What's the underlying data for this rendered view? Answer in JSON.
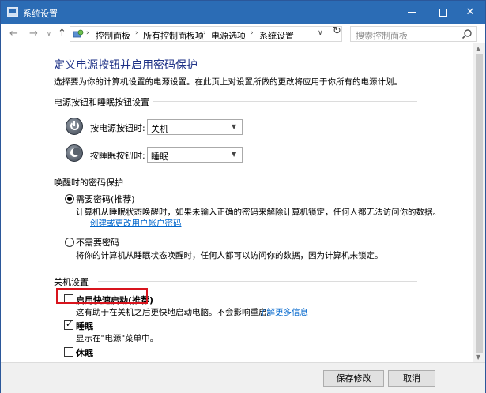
{
  "window": {
    "title": "系统设置",
    "minimize_icon": "minimize-icon",
    "maximize_icon": "maximize-icon",
    "close_icon": "close-icon",
    "close_glyph": "✕"
  },
  "navbar": {
    "back_glyph": "←",
    "forward_glyph": "→",
    "history_glyph": "∨",
    "up_glyph": "↑",
    "breadcrumb": [
      "控制面板",
      "所有控制面板项",
      "电源选项",
      "系统设置"
    ],
    "separator": "›",
    "dropdown_glyph": "∨",
    "refresh_glyph": "↻",
    "search_placeholder": "搜索控制面板"
  },
  "main": {
    "title": "定义电源按钮并启用密码保护",
    "description": "选择要为你的计算机设置的电源设置。在此页上对设置所做的更改将应用于你所有的电源计划。",
    "buttons_section": {
      "title": "电源按钮和睡眠按钮设置",
      "power_label": "按电源按钮时:",
      "power_value": "关机",
      "sleep_label": "按睡眠按钮时:",
      "sleep_value": "睡眠"
    },
    "password_section": {
      "title": "唤醒时的密码保护",
      "require_label": "需要密码(推荐)",
      "require_desc": "计算机从睡眠状态唤醒时，如果未输入正确的密码来解除计算机锁定，任何人都无法访问你的数据。",
      "require_link": "创建或更改用户帐户密码",
      "require_selected": true,
      "norequire_label": "不需要密码",
      "norequire_desc": "将你的计算机从睡眠状态唤醒时，任何人都可以访问你的数据，因为计算机未锁定。"
    },
    "shutdown_section": {
      "title": "关机设置",
      "fast_startup_label": "启用快速启动(推荐)",
      "fast_startup_checked": false,
      "fast_startup_desc": "这有助于在关机之后更快地启动电脑。不会影响重启。",
      "fast_startup_link": "了解更多信息",
      "sleep_label": "睡眠",
      "sleep_checked": true,
      "sleep_desc": "显示在\"电源\"菜单中。",
      "hibernate_label": "休眠",
      "hibernate_checked": false,
      "check_glyph": "✓"
    }
  },
  "scrollbar": {
    "up_glyph": "▲",
    "down_glyph": "▼"
  },
  "footer": {
    "save_label": "保存修改",
    "cancel_label": "取消"
  },
  "colors": {
    "titlebar": "#2b6cb5",
    "page_title": "#1e3287",
    "link": "#0066cc",
    "highlight_box": "#d8141d"
  }
}
